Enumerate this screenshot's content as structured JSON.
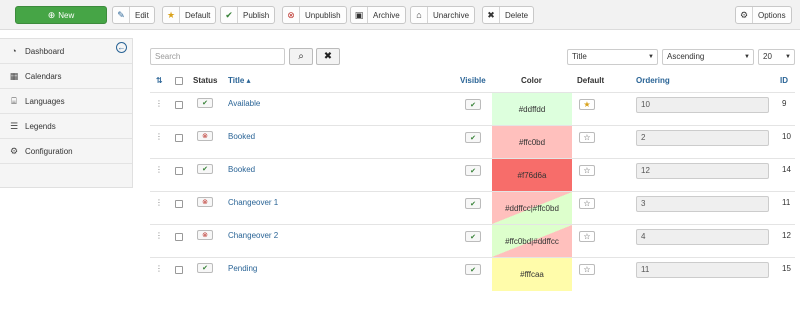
{
  "toolbar": {
    "new": "New",
    "edit": "Edit",
    "default": "Default",
    "publish": "Publish",
    "unpublish": "Unpublish",
    "archive": "Archive",
    "unarchive": "Unarchive",
    "delete": "Delete",
    "options": "Options"
  },
  "sidebar": {
    "items": [
      {
        "label": "Dashboard",
        "icon": "dashboard-icon"
      },
      {
        "label": "Calendars",
        "icon": "calendar-icon"
      },
      {
        "label": "Languages",
        "icon": "languages-icon"
      },
      {
        "label": "Legends",
        "icon": "list-icon"
      },
      {
        "label": "Configuration",
        "icon": "gear-icon"
      }
    ]
  },
  "filters": {
    "search_placeholder": "Search",
    "sort_field": "Title",
    "sort_direction": "Ascending",
    "limit": "20"
  },
  "table": {
    "headers": {
      "status": "Status",
      "title": "Title",
      "visible": "Visible",
      "color": "Color",
      "default": "Default",
      "ordering": "Ordering",
      "id": "ID"
    },
    "rows": [
      {
        "status": "published",
        "title": "Available",
        "visible": true,
        "color_text": "#ddffdd",
        "default": true,
        "ordering": "10",
        "id": "9",
        "colors": [
          "#ddffdd"
        ]
      },
      {
        "status": "unpublished",
        "title": "Booked",
        "visible": true,
        "color_text": "#ffc0bd",
        "default": false,
        "ordering": "2",
        "id": "10",
        "colors": [
          "#ffc0bd"
        ]
      },
      {
        "status": "published",
        "title": "Booked",
        "visible": true,
        "color_text": "#f76d6a",
        "default": false,
        "ordering": "12",
        "id": "14",
        "colors": [
          "#f76d6a"
        ]
      },
      {
        "status": "unpublished",
        "title": "Changeover 1",
        "visible": true,
        "color_text": "#ddffcc|#ffc0bd",
        "default": false,
        "ordering": "3",
        "id": "11",
        "colors": [
          "#ddffcc",
          "#ffc0bd"
        ]
      },
      {
        "status": "unpublished",
        "title": "Changeover 2",
        "visible": true,
        "color_text": "#ffc0bd|#ddffcc",
        "default": false,
        "ordering": "4",
        "id": "12",
        "colors": [
          "#ffc0bd",
          "#ddffcc"
        ]
      },
      {
        "status": "published",
        "title": "Pending",
        "visible": true,
        "color_text": "#fffcaa",
        "default": false,
        "ordering": "11",
        "id": "15",
        "colors": [
          "#fffcaa"
        ]
      }
    ]
  }
}
